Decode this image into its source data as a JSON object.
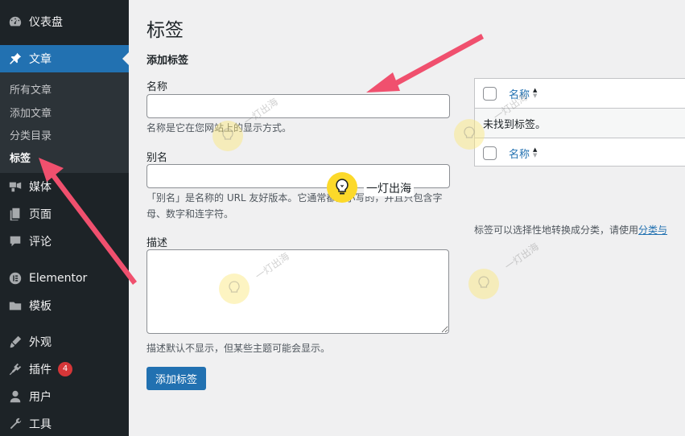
{
  "sidebar": {
    "items": [
      {
        "label": "仪表盘",
        "icon": "dashboard-icon"
      },
      {
        "label": "文章",
        "icon": "pin-icon",
        "active": true
      },
      {
        "label": "媒体",
        "icon": "media-icon"
      },
      {
        "label": "页面",
        "icon": "page-icon"
      },
      {
        "label": "评论",
        "icon": "comment-icon"
      },
      {
        "label": "Elementor",
        "icon": "elementor-icon"
      },
      {
        "label": "模板",
        "icon": "folder-icon"
      },
      {
        "label": "外观",
        "icon": "brush-icon"
      },
      {
        "label": "插件",
        "icon": "plugin-icon",
        "badge": "4"
      },
      {
        "label": "用户",
        "icon": "user-icon"
      },
      {
        "label": "工具",
        "icon": "wrench-icon"
      }
    ],
    "submenu": [
      "所有文章",
      "添加文章",
      "分类目录",
      "标签"
    ]
  },
  "page": {
    "title": "标签",
    "form_heading": "添加标签",
    "name_label": "名称",
    "name_value": "",
    "name_desc": "名称是它在您网站上的显示方式。",
    "slug_label": "别名",
    "slug_value": "",
    "slug_desc": "「别名」是名称的 URL 友好版本。它通常都是小写的，并且只包含字母、数字和连字符。",
    "description_label": "描述",
    "description_value": "",
    "description_desc": "描述默认不显示，但某些主题可能会显示。",
    "submit_label": "添加标签"
  },
  "table": {
    "column_name": "名称",
    "empty_message": "未找到标签。",
    "convert_note": "标签可以选择性地转换成分类，请使用",
    "convert_link": "分类与"
  },
  "watermark": {
    "text": "一灯出海"
  },
  "colors": {
    "sidebar_bg": "#1d2327",
    "submenu_bg": "#2c3338",
    "accent": "#2271b1",
    "badge": "#d63638",
    "arrow": "#f0506e"
  }
}
